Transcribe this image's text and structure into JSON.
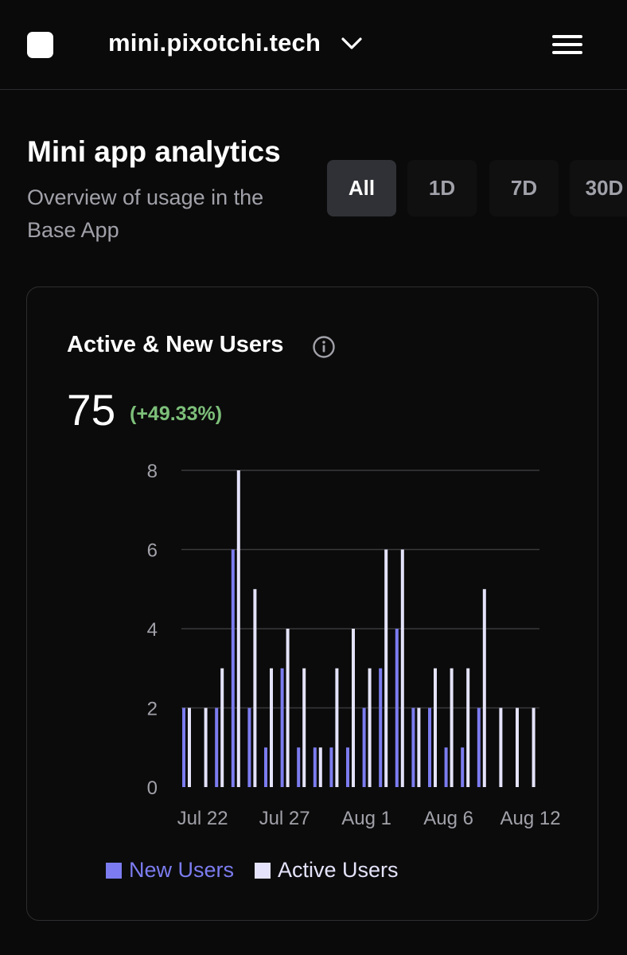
{
  "header": {
    "site_name": "mini.pixotchi.tech",
    "logo_icon": "app-logo-icon",
    "dropdown_icon": "chevron-down-icon",
    "menu_icon": "hamburger-menu-icon"
  },
  "page": {
    "title": "Mini app analytics",
    "subtitle": "Overview of usage in the Base App"
  },
  "range_tabs": [
    {
      "label": "All",
      "selected": true
    },
    {
      "label": "1D",
      "selected": false
    },
    {
      "label": "7D",
      "selected": false
    },
    {
      "label": "30D",
      "selected": false
    }
  ],
  "card": {
    "title": "Active & New Users",
    "info_icon": "info-icon",
    "total": "75",
    "change": "(+49.33%)"
  },
  "colors": {
    "background": "#0a0a0a",
    "new_users": "#7c7cf0",
    "active_users": "#e4e3fb",
    "positive_change": "#7dbf7a"
  },
  "chart_data": {
    "type": "bar",
    "xlabel": "",
    "ylabel": "",
    "ylim": [
      0,
      8
    ],
    "yticks": [
      0,
      2,
      4,
      6,
      8
    ],
    "grid": true,
    "legend_position": "bottom-left",
    "x_tick_labels": [
      "Jul 22",
      "Jul 27",
      "Aug 1",
      "Aug 6",
      "Aug 12"
    ],
    "x_tick_indices": [
      1,
      6,
      11,
      16,
      21
    ],
    "x": [
      "Jul 21",
      "Jul 22",
      "Jul 23",
      "Jul 24",
      "Jul 25",
      "Jul 26",
      "Jul 27",
      "Jul 28",
      "Jul 29",
      "Jul 30",
      "Jul 31",
      "Aug 1",
      "Aug 2",
      "Aug 3",
      "Aug 4",
      "Aug 5",
      "Aug 6",
      "Aug 7",
      "Aug 8",
      "Aug 9",
      "Aug 10",
      "Aug 11"
    ],
    "series": [
      {
        "name": "New Users",
        "values": [
          2,
          0,
          2,
          6,
          2,
          1,
          3,
          1,
          1,
          1,
          1,
          2,
          3,
          4,
          2,
          2,
          1,
          1,
          2,
          0,
          0,
          0
        ]
      },
      {
        "name": "Active Users",
        "values": [
          2,
          2,
          3,
          8,
          5,
          3,
          4,
          3,
          1,
          3,
          4,
          3,
          6,
          6,
          2,
          3,
          3,
          3,
          5,
          2,
          2,
          2
        ]
      }
    ]
  }
}
